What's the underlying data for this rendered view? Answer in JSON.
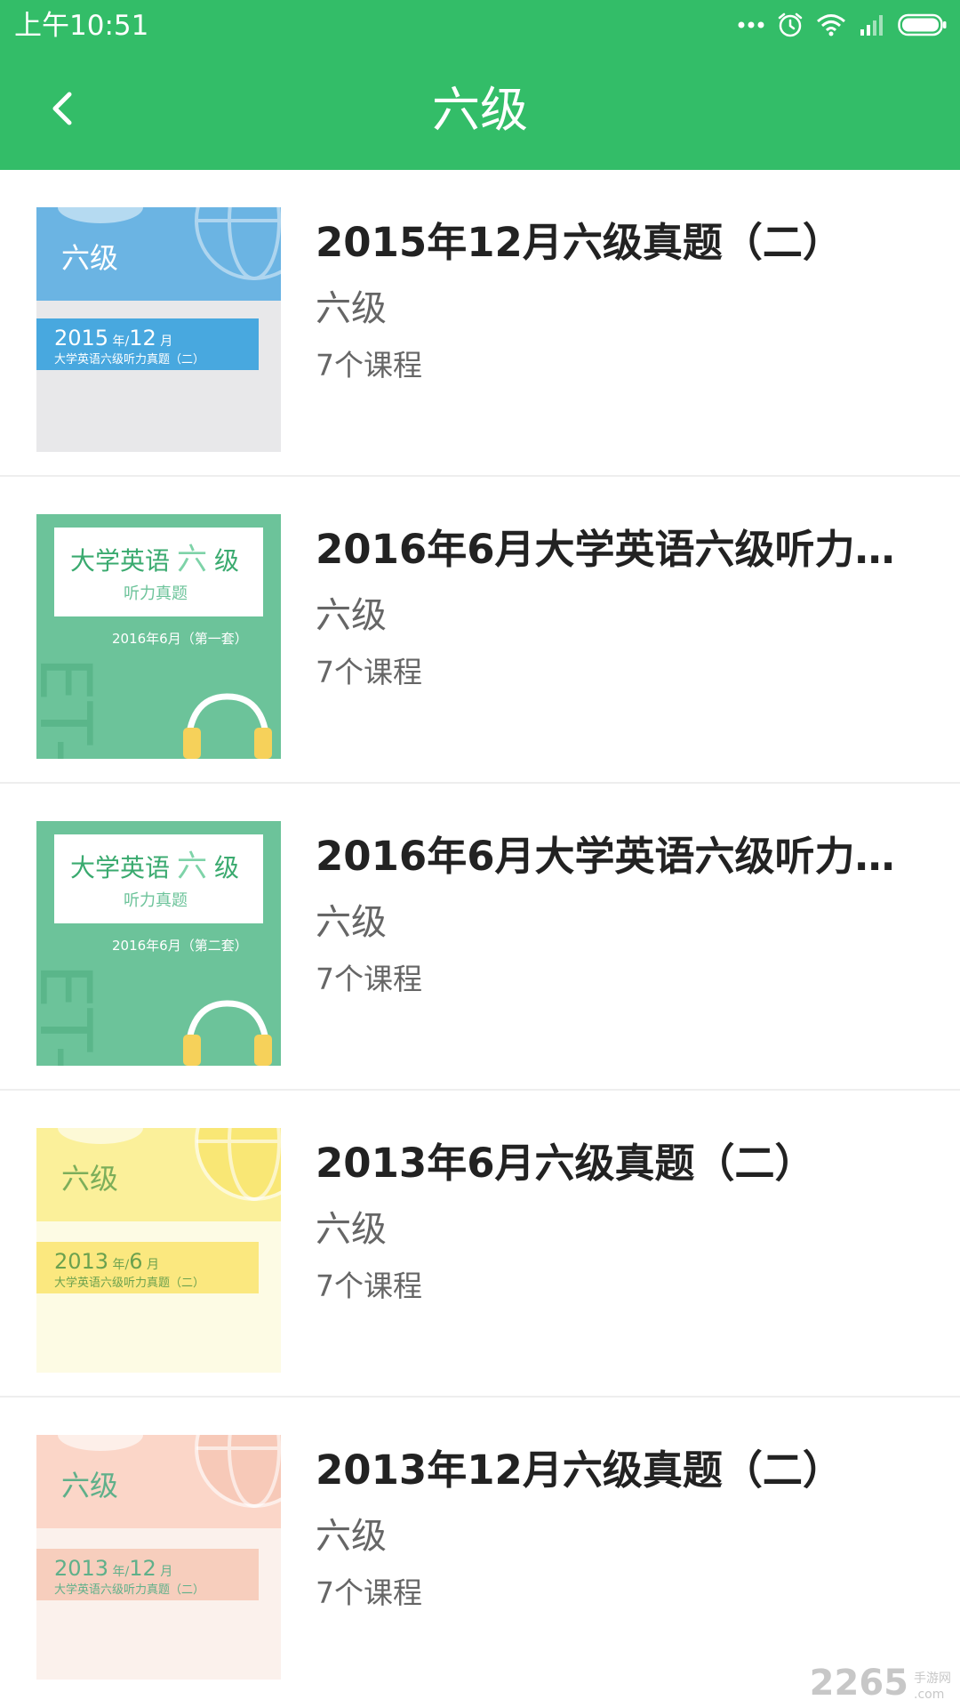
{
  "status_bar": {
    "time": "上午10:51",
    "icons": [
      "more-dots-icon",
      "alarm-icon",
      "wifi-icon",
      "signal-icon",
      "battery-icon"
    ]
  },
  "app_bar": {
    "title": "六级",
    "back_icon": "back-arrow-icon"
  },
  "colors": {
    "primary": "#33bd68",
    "title_text": "#222222",
    "secondary_text": "#666666"
  },
  "courses": [
    {
      "title": "2015年12月六级真题（二）",
      "category": "六级",
      "count": "7个课程",
      "cover": {
        "style": "level-card",
        "palette": [
          "#6bb4e3",
          "#e8e8ea",
          "#48a8df"
        ],
        "level_text": "六级",
        "year": "2015",
        "month": "12",
        "subtitle": "大学英语六级听力真题（二）"
      }
    },
    {
      "title": "2016年6月大学英语六级听力真题...",
      "category": "六级",
      "count": "7个课程",
      "cover": {
        "style": "listening-card",
        "palette": [
          "#6cc39a",
          "#ffffff",
          "#3aaa6f"
        ],
        "heading": "大学英语 六 级",
        "heading_parts": [
          "大学英语",
          "六",
          "级"
        ],
        "subheading": "听力真题",
        "set_label": "2016年6月（第一套）"
      }
    },
    {
      "title": "2016年6月大学英语六级听力真题...",
      "category": "六级",
      "count": "7个课程",
      "cover": {
        "style": "listening-card",
        "palette": [
          "#6cc39a",
          "#ffffff",
          "#3aaa6f"
        ],
        "heading": "大学英语 六 级",
        "heading_parts": [
          "大学英语",
          "六",
          "级"
        ],
        "subheading": "听力真题",
        "set_label": "2016年6月（第二套）"
      }
    },
    {
      "title": "2013年6月六级真题（二）",
      "category": "六级",
      "count": "7个课程",
      "cover": {
        "style": "level-card",
        "palette": [
          "#fbf09a",
          "#fdfbe4",
          "#f9e25e"
        ],
        "level_text": "六级",
        "year": "2013",
        "month": "6",
        "subtitle": "大学英语六级听力真题（二）"
      }
    },
    {
      "title": "2013年12月六级真题（二）",
      "category": "六级",
      "count": "7个课程",
      "cover": {
        "style": "level-card",
        "palette": [
          "#fbd6c8",
          "#fbf1ec",
          "#f6c2ae"
        ],
        "level_text": "六级",
        "year": "2013",
        "month": "12",
        "subtitle": "大学英语六级听力真题（二）"
      }
    }
  ],
  "watermark": {
    "digits": "2265",
    "suffix": ".com",
    "label": "手游网"
  }
}
